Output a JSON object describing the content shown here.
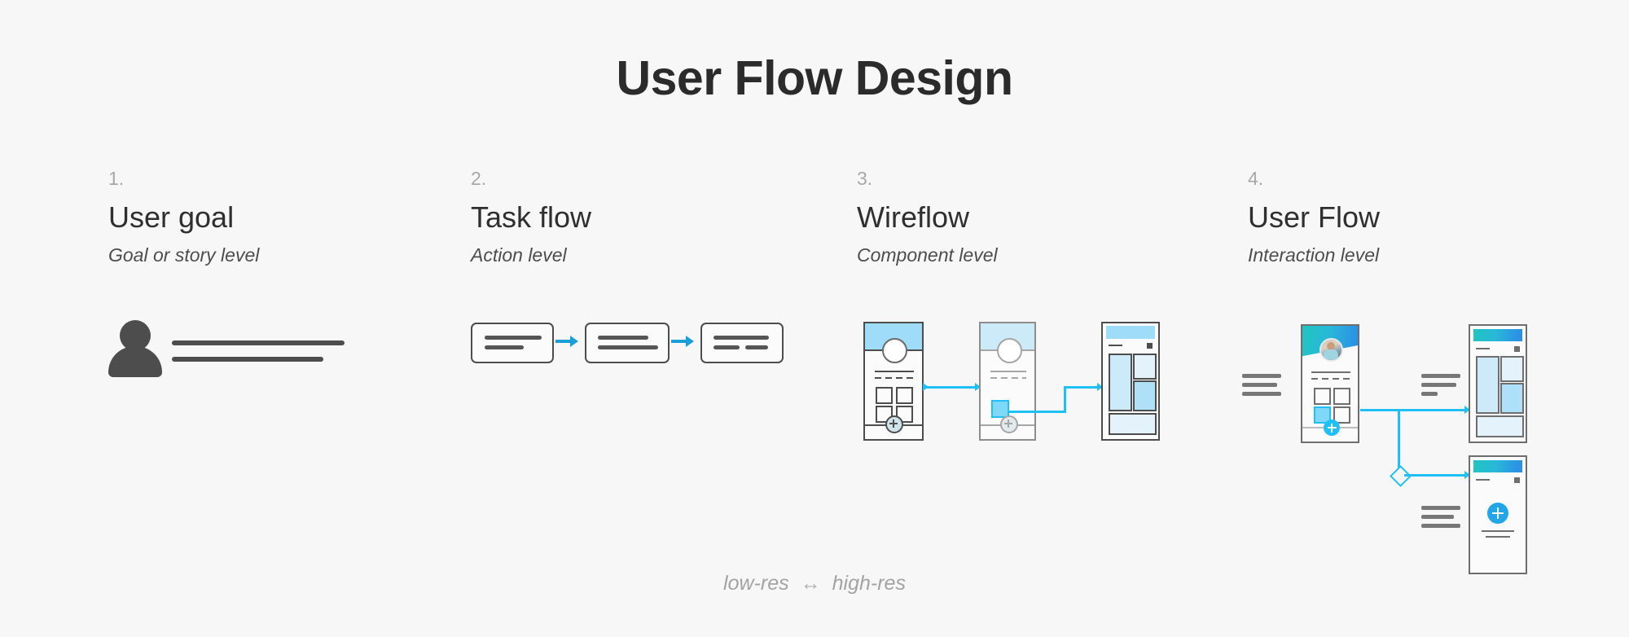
{
  "title": "User Flow Design",
  "caption": {
    "low": "low-res",
    "arrow": "↔",
    "high": "high-res"
  },
  "colors": {
    "background": "#f7f7f7",
    "title_text": "#2b2b2b",
    "step_number": "#a8a8a8",
    "step_title": "#2f2f2f",
    "step_subtitle": "#4d4d4d",
    "arrow_blue": "#1b9fd8",
    "connector_cyan": "#1ec0f5",
    "wire_stroke": "#4d4d4d",
    "wire_stroke_faded": "#9a9a9a",
    "header_blue": "#9fdcf7",
    "header_blue_light": "#cdeaf8",
    "panel_blue": "#aee0f7",
    "panel_blue_light": "#e4f2fb",
    "gradient_start": "#20c5c0",
    "gradient_end": "#2b8ae8",
    "fab_blue": "#21a7e8",
    "caption_text": "#a3a3a3"
  },
  "steps": [
    {
      "number": "1.",
      "title": "User goal",
      "subtitle": "Goal or story level"
    },
    {
      "number": "2.",
      "title": "Task flow",
      "subtitle": "Action level"
    },
    {
      "number": "3.",
      "title": "Wireflow",
      "subtitle": "Component level"
    },
    {
      "number": "4.",
      "title": "User Flow",
      "subtitle": "Interaction level"
    }
  ],
  "illustrations": {
    "user_goal": {
      "icon": "person-silhouette-icon",
      "text_lines": 2
    },
    "task_flow": {
      "boxes": 3,
      "arrows": 2,
      "box_lines": [
        2,
        2,
        3
      ]
    },
    "wireflow": {
      "screens": 3,
      "screen_1": {
        "state": "active",
        "grid_items": 4,
        "has_avatar_circle": true,
        "has_fab": true
      },
      "screen_2": {
        "state": "faded",
        "grid_items": 1,
        "has_avatar_circle": true,
        "has_fab": true,
        "highlighted_tile": true
      },
      "screen_3": {
        "state": "active",
        "panels": 4
      },
      "connectors": 2
    },
    "user_flow": {
      "screens": 3,
      "screen_1": {
        "name": "profile-screen",
        "has_avatar_photo": true,
        "grid_items": 4,
        "highlighted_tile": true,
        "has_fab": true
      },
      "screen_2": {
        "name": "dashboard-screen",
        "panels": 4
      },
      "screen_3": {
        "name": "create-screen",
        "has_large_fab": true
      },
      "decision_node": "diamond",
      "annotation_groups": 3
    }
  }
}
